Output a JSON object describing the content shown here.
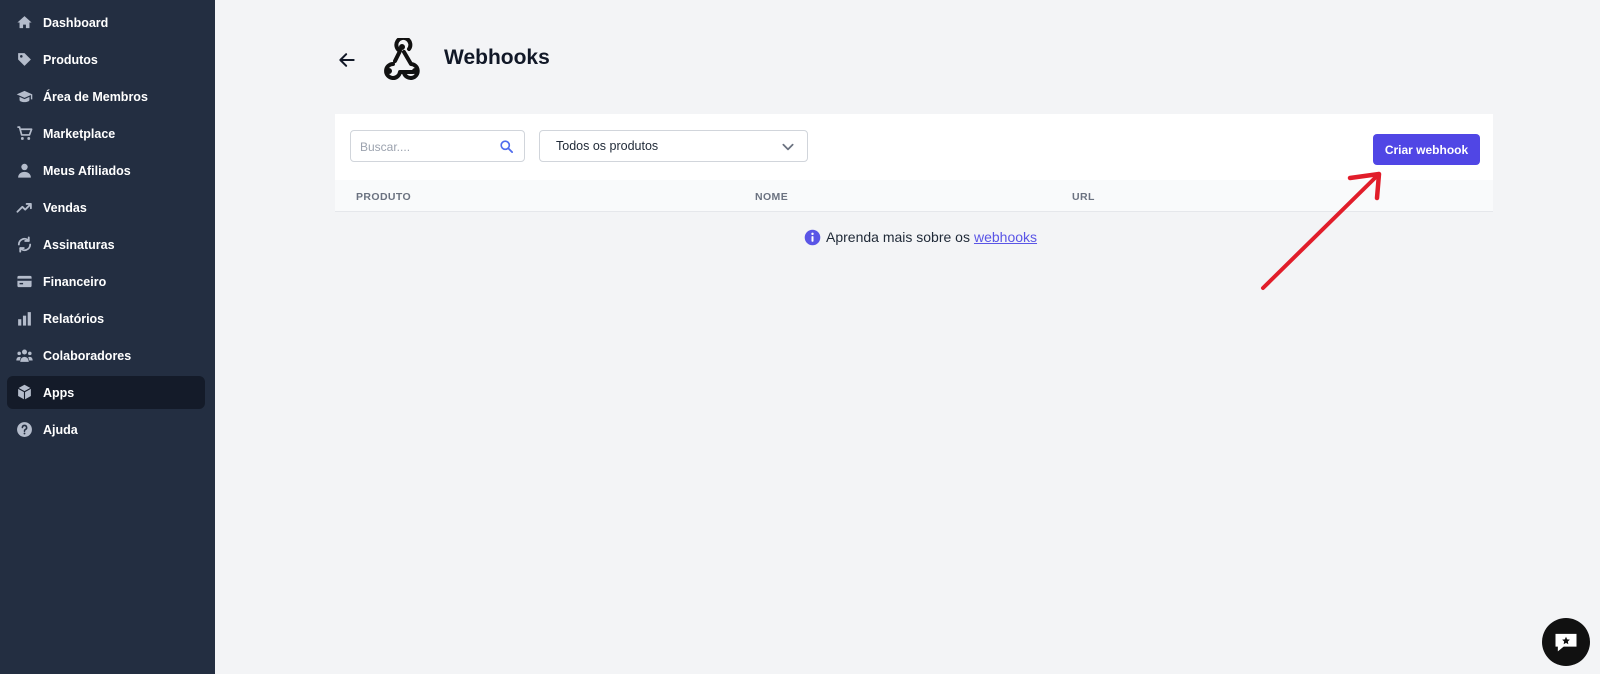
{
  "sidebar": {
    "items": [
      {
        "label": "Dashboard",
        "icon": "home-icon"
      },
      {
        "label": "Produtos",
        "icon": "tag-icon"
      },
      {
        "label": "Área de Membros",
        "icon": "graduation-cap-icon"
      },
      {
        "label": "Marketplace",
        "icon": "cart-icon"
      },
      {
        "label": "Meus Afiliados",
        "icon": "user-icon"
      },
      {
        "label": "Vendas",
        "icon": "trending-up-icon"
      },
      {
        "label": "Assinaturas",
        "icon": "refresh-icon"
      },
      {
        "label": "Financeiro",
        "icon": "credit-card-icon"
      },
      {
        "label": "Relatórios",
        "icon": "bar-chart-icon"
      },
      {
        "label": "Colaboradores",
        "icon": "users-icon"
      },
      {
        "label": "Apps",
        "icon": "cubes-icon",
        "active": true
      },
      {
        "label": "Ajuda",
        "icon": "help-circle-icon"
      }
    ]
  },
  "header": {
    "title": "Webhooks"
  },
  "toolbar": {
    "search_placeholder": "Buscar....",
    "product_filter": "Todos os produtos",
    "create_button": "Criar webhook"
  },
  "table": {
    "columns": [
      "PRODUTO",
      "NOME",
      "URL"
    ]
  },
  "info": {
    "text": "Aprenda mais sobre os",
    "link": "webhooks"
  },
  "colors": {
    "sidebar_bg": "#232e41",
    "active_item_bg": "#141b29",
    "accent": "#5046e5",
    "annotation_arrow": "#e11d2a"
  }
}
